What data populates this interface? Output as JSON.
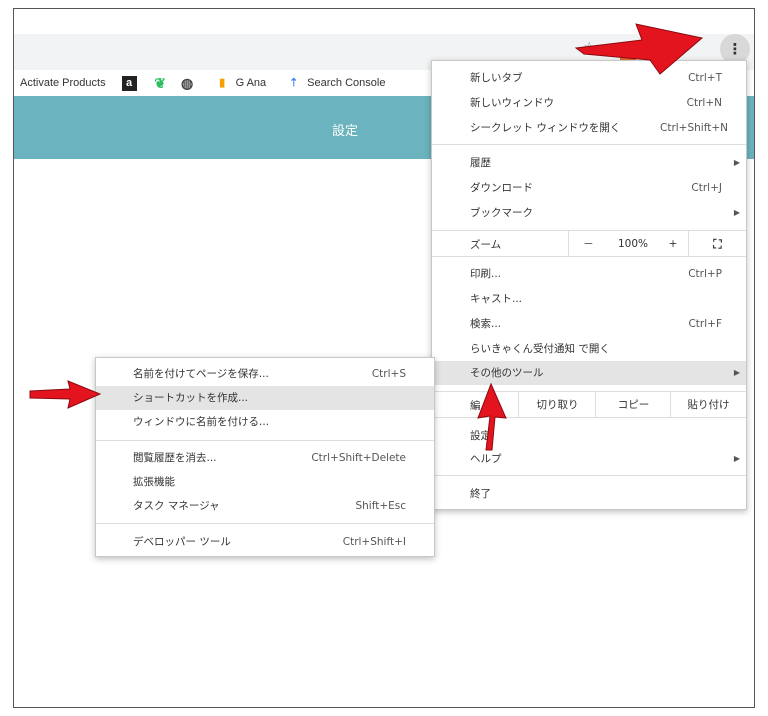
{
  "bookmarks": {
    "activate": "Activate Products",
    "amazon_glyph": "a",
    "ganalytics": "G Ana",
    "search_console": "Search Console"
  },
  "settings_title": "設定",
  "toolbar": {
    "menu_glyph": "⋮"
  },
  "main_menu": {
    "new_tab": {
      "label": "新しいタブ",
      "shortcut": "Ctrl+T"
    },
    "new_window": {
      "label": "新しいウィンドウ",
      "shortcut": "Ctrl+N"
    },
    "incognito": {
      "label": "シークレット ウィンドウを開く",
      "shortcut": "Ctrl+Shift+N"
    },
    "history": {
      "label": "履歴"
    },
    "downloads": {
      "label": "ダウンロード",
      "shortcut": "Ctrl+J"
    },
    "bookmarks": {
      "label": "ブックマーク"
    },
    "zoom": {
      "label": "ズーム",
      "minus": "－",
      "value": "100%",
      "plus": "+",
      "fullscreen": "⛶"
    },
    "print": {
      "label": "印刷...",
      "shortcut": "Ctrl+P"
    },
    "cast": {
      "label": "キャスト..."
    },
    "find": {
      "label": "検索...",
      "shortcut": "Ctrl+F"
    },
    "open_with": {
      "label": "らいきゃくん受付通知 で開く"
    },
    "more_tools": {
      "label": "その他のツール"
    },
    "edit": {
      "label": "編",
      "cut": "切り取り",
      "copy": "コピー",
      "paste": "貼り付け"
    },
    "settings": {
      "label": "設定"
    },
    "help": {
      "label": "ヘルプ"
    },
    "exit": {
      "label": "終了"
    }
  },
  "sub_menu": {
    "save_page": {
      "label": "名前を付けてページを保存...",
      "shortcut": "Ctrl+S"
    },
    "create_shortcut": {
      "label": "ショートカットを作成..."
    },
    "name_window": {
      "label": "ウィンドウに名前を付ける..."
    },
    "clear_data": {
      "label": "閲覧履歴を消去...",
      "shortcut": "Ctrl+Shift+Delete"
    },
    "extensions": {
      "label": "拡張機能"
    },
    "task_manager": {
      "label": "タスク マネージャ",
      "shortcut": "Shift+Esc"
    },
    "dev_tools": {
      "label": "デベロッパー ツール",
      "shortcut": "Ctrl+Shift+I"
    }
  },
  "colors": {
    "settings_bar": "#6bb3be",
    "highlight": "#e4e4e4",
    "annotation_arrow": "#e4141e"
  }
}
